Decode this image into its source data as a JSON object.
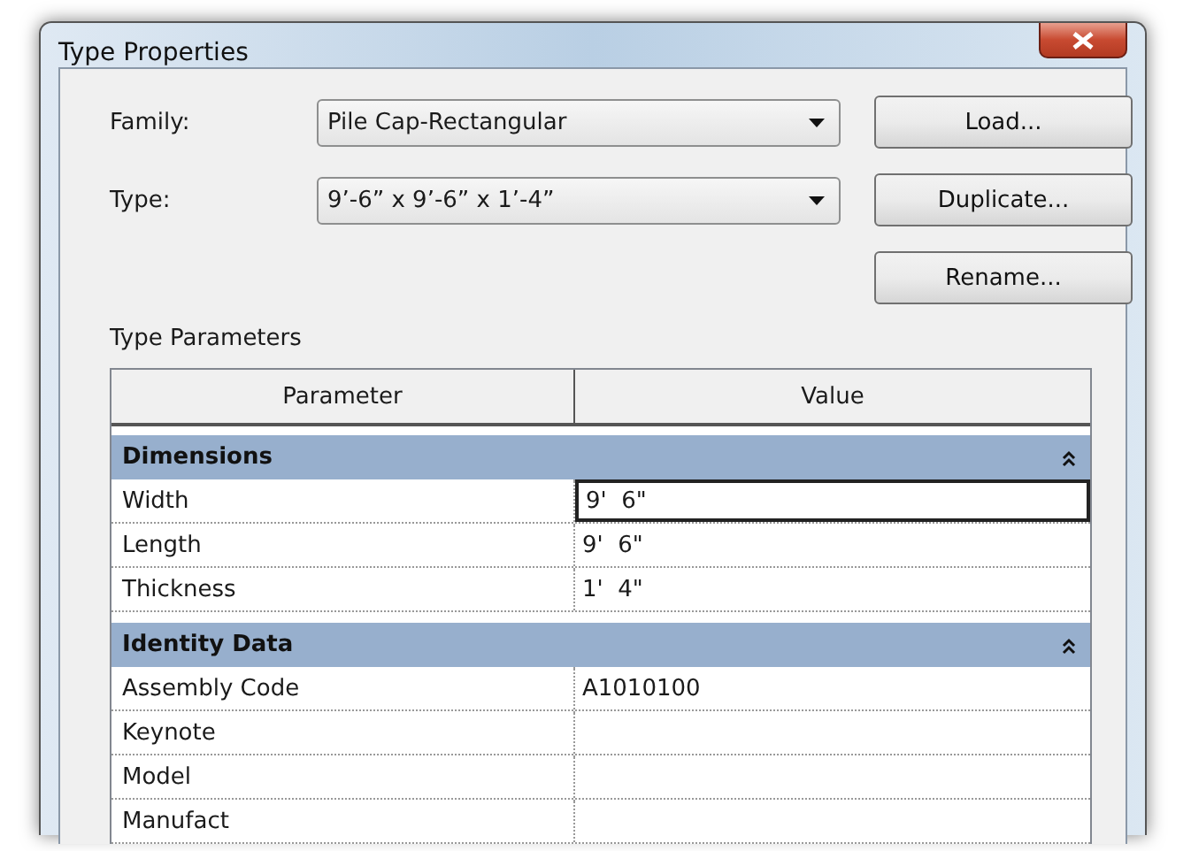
{
  "window": {
    "title": "Type Properties"
  },
  "fields": [
    {
      "label": "Family:",
      "value": "Pile Cap-Rectangular"
    },
    {
      "label": "Type:",
      "value": "9’-6” x 9’-6” x 1’-4”"
    }
  ],
  "buttons": [
    "Load...",
    "Duplicate...",
    "Rename..."
  ],
  "section_label": "Type Parameters",
  "table": {
    "columns": [
      "Parameter",
      "Value"
    ],
    "groups": [
      {
        "name": "Dimensions",
        "expanded": true,
        "rows": [
          {
            "parameter": "Width",
            "value": "9'  6\"",
            "selected": true
          },
          {
            "parameter": "Length",
            "value": "9'  6\"",
            "selected": false
          },
          {
            "parameter": "Thickness",
            "value": "1'  4\"",
            "selected": false
          }
        ]
      },
      {
        "name": "Identity Data",
        "expanded": true,
        "rows": [
          {
            "parameter": "Assembly Code",
            "value": "A1010100",
            "selected": false
          },
          {
            "parameter": "Keynote",
            "value": "",
            "selected": false
          },
          {
            "parameter": "Model",
            "value": "",
            "selected": false
          },
          {
            "parameter": "Manufact",
            "value": "",
            "selected": false
          }
        ]
      }
    ]
  }
}
